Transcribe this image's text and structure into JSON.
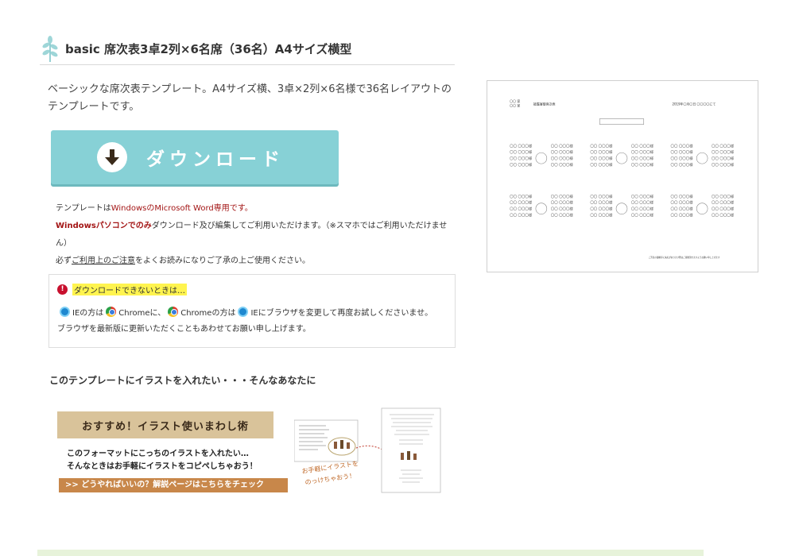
{
  "heading": {
    "title": "basic 席次表3卓2列×6名席（36名）A4サイズ横型",
    "icon": "leaf-icon"
  },
  "description": "ベーシックな席次表テンプレート。A4サイズ横、3卓×2列×6名様で36名レイアウトのテンプレートです。",
  "download_button": {
    "label": "ダウンロード",
    "icon": "download-arrow-icon",
    "color": "#87d1d6"
  },
  "notes": {
    "line1_prefix": "テンプレートは",
    "line1_red": "WindowsのMicrosoft Word専用です。",
    "line2_bold": "Windowsパソコンでのみ",
    "line2_rest": "ダウンロード及び編集してご利用いただけます。（※スマホではご利用いただけません）",
    "line3_prefix": "必ず",
    "line3_link": "ご利用上のご注意",
    "line3_rest": "をよくお読みになりご了承の上ご使用ください。"
  },
  "info_box": {
    "highlight": "ダウンロードできないときは…",
    "ie1": "IEの方は",
    "chrome1": "Chromeに、",
    "chrome2": "Chromeの方は",
    "ie2": "IEにブラウザを変更して再度お試しくださいませ。",
    "line3": "ブラウザを最新版に更新いただくこともあわせてお願い申し上げます。"
  },
  "section_heading": "このテンプレートにイラストを入れたい・・・そんなあなたに",
  "banner": {
    "title": "おすすめ！イラスト使いまわし術",
    "line1": "このフォーマットにこっちのイラストを入れたい…",
    "line2": "そんなときはお手軽にイラストをコピペしちゃおう！",
    "link": ">> どうやればいいの？解説ページはこちらをチェック",
    "handwritten": "お手軽にイラストをのっけちゃおう！"
  },
  "preview": {
    "names": "〇〇 家 / 〇〇 家",
    "title": "披露宴御席次表",
    "date": "2019年〇月〇日 〇〇〇〇にて",
    "note": "ご芳名の御順序に失礼があります際はご容赦頂きますようお願い申し上げます"
  }
}
